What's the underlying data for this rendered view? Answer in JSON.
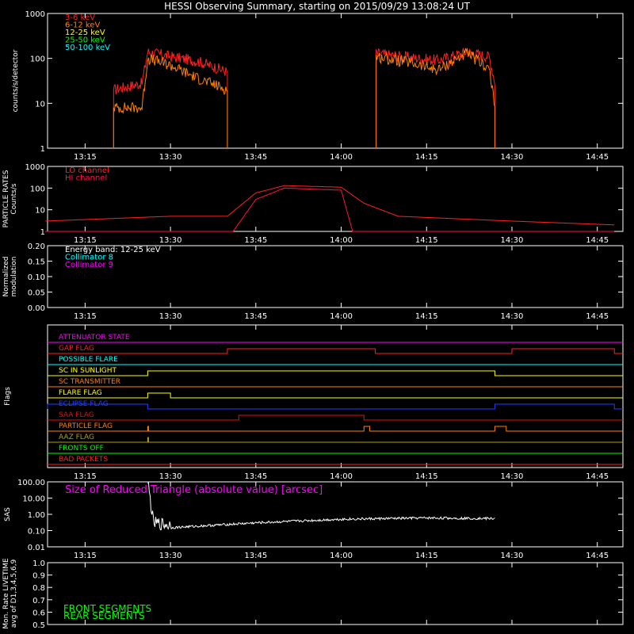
{
  "title": "HESSI Observing Summary, starting on 2015/09/29 13:08:24 UT",
  "time_ticks": [
    "13:15",
    "13:30",
    "13:45",
    "14:00",
    "14:15",
    "14:30",
    "14:45"
  ],
  "colors": {
    "red": "#ff2020",
    "orange": "#ff8000",
    "yellow": "#ffff00",
    "green": "#00ff00",
    "cyan": "#00ffff",
    "magenta": "#ff00ff",
    "crimson": "#ff1040",
    "blue": "#2040ff",
    "olive": "#b0a000",
    "darkred": "#e01010",
    "white": "#ffffff"
  },
  "chart_data": [
    {
      "id": "lightcurves",
      "type": "line",
      "ylabel": "counts/s/detector",
      "yscale": "log",
      "ylim": [
        1,
        1000
      ],
      "ytick_labels": [
        "1",
        "10",
        "100",
        "1000"
      ],
      "legend": [
        {
          "name": "3-6 keV",
          "color": "red"
        },
        {
          "name": "6-12 keV",
          "color": "orange"
        },
        {
          "name": "12-25 keV",
          "color": "yellow"
        },
        {
          "name": "25-50 keV",
          "color": "green"
        },
        {
          "name": "50-100 keV",
          "color": "cyan"
        }
      ],
      "series": [
        {
          "name": "3-6 keV",
          "color": "red",
          "x": [
            "13:20",
            "13:25",
            "13:26",
            "13:30",
            "13:35",
            "13:40",
            "14:06",
            "14:12",
            "14:17",
            "14:22",
            "14:26",
            "14:27"
          ],
          "y": [
            20,
            28,
            140,
            110,
            85,
            50,
            130,
            105,
            90,
            140,
            110,
            30
          ]
        },
        {
          "name": "6-12 keV",
          "color": "orange",
          "x": [
            "13:20",
            "13:25",
            "13:26",
            "13:30",
            "13:35",
            "13:40",
            "14:06",
            "14:12",
            "14:17",
            "14:22",
            "14:26",
            "14:27"
          ],
          "y": [
            8,
            8,
            100,
            70,
            35,
            20,
            110,
            80,
            55,
            130,
            60,
            8
          ]
        },
        {
          "name": "12-25 keV",
          "color": "yellow",
          "x": [
            "13:20",
            "13:40",
            "14:06",
            "14:27"
          ],
          "y": [
            12,
            12,
            12,
            10
          ]
        },
        {
          "name": "25-50 keV",
          "color": "green",
          "x": [
            "13:20",
            "13:40",
            "14:06",
            "14:27"
          ],
          "y": [
            18,
            18,
            20,
            17
          ]
        },
        {
          "name": "50-100 keV",
          "color": "cyan",
          "x": [
            "13:20",
            "13:40",
            "14:06",
            "14:27"
          ],
          "y": [
            28,
            30,
            40,
            33
          ]
        }
      ]
    },
    {
      "id": "particle",
      "type": "line",
      "ylabel": "PARTICLE RATES Counts/s",
      "yscale": "log",
      "ylim": [
        1,
        1000
      ],
      "ytick_labels": [
        "1",
        "10",
        "100",
        "1000"
      ],
      "legend": [
        {
          "name": "LO channel",
          "color": "red"
        },
        {
          "name": "HI channel",
          "color": "crimson"
        }
      ],
      "series": [
        {
          "name": "LO channel",
          "color": "red",
          "x": [
            "13:08",
            "13:30",
            "13:40",
            "13:45",
            "13:50",
            "14:00",
            "14:04",
            "14:10",
            "14:30",
            "14:48"
          ],
          "y": [
            3,
            5,
            5,
            60,
            130,
            110,
            20,
            5,
            3,
            2
          ]
        },
        {
          "name": "HI channel",
          "color": "crimson",
          "x": [
            "13:08",
            "13:41",
            "13:45",
            "13:50",
            "14:00",
            "14:02",
            "14:48"
          ],
          "y": [
            1,
            1,
            30,
            100,
            80,
            1,
            1
          ]
        }
      ]
    },
    {
      "id": "modulation",
      "type": "line",
      "ylabel": "Normalized modulation",
      "ylim": [
        0,
        0.2
      ],
      "ytick_labels": [
        "0.00",
        "0.05",
        "0.10",
        "0.15",
        "0.20"
      ],
      "legend": [
        {
          "name": "Energy band: 12-25 keV",
          "color": "white"
        },
        {
          "name": "Collimator 8",
          "color": "cyan"
        },
        {
          "name": "Collimator 9",
          "color": "magenta"
        }
      ],
      "series": [
        {
          "name": "Collimator 8",
          "color": "cyan",
          "x": [
            "13:20",
            "13:40",
            "14:06",
            "14:30"
          ],
          "y": [
            0.1,
            0.11,
            0.14,
            0.11
          ]
        },
        {
          "name": "Collimator 9",
          "color": "magenta",
          "x": [
            "13:08",
            "14:48"
          ],
          "y": [
            0,
            0
          ]
        }
      ]
    },
    {
      "id": "flags",
      "type": "line",
      "ylabel": "Flags",
      "flags": [
        {
          "name": "ATTENUATOR STATE",
          "color": "magenta",
          "highs": []
        },
        {
          "name": "GAP FLAG",
          "color": "red",
          "highs": [
            [
              "13:40",
              "14:06"
            ],
            [
              "14:30",
              "14:48"
            ]
          ]
        },
        {
          "name": "POSSIBLE FLARE",
          "color": "cyan",
          "highs": []
        },
        {
          "name": "SC IN SUNLIGHT",
          "color": "yellow",
          "highs": [
            [
              "13:26",
              "14:27"
            ]
          ]
        },
        {
          "name": "SC TRANSMITTER",
          "color": "orange",
          "highs": []
        },
        {
          "name": "FLARE FLAG",
          "color": "yellow",
          "highs": [
            [
              "13:26",
              "13:30"
            ]
          ]
        },
        {
          "name": "ECLIPSE FLAG",
          "color": "blue",
          "highs": [
            [
              "13:08",
              "13:26"
            ],
            [
              "14:27",
              "14:48"
            ]
          ]
        },
        {
          "name": "SAA FLAG",
          "color": "darkred",
          "highs": [
            [
              "13:42",
              "14:04"
            ]
          ]
        },
        {
          "name": "PARTICLE FLAG",
          "color": "orange",
          "highs": [
            [
              "13:26",
              "13:26"
            ],
            [
              "14:04",
              "14:05"
            ],
            [
              "14:27",
              "14:29"
            ]
          ]
        },
        {
          "name": "AAZ FLAG",
          "color": "olive",
          "highs": [
            [
              "13:26",
              "13:26"
            ]
          ]
        },
        {
          "name": "FRONTS OFF",
          "color": "green",
          "highs": []
        },
        {
          "name": "BAD PACKETS",
          "color": "red",
          "highs": []
        }
      ]
    },
    {
      "id": "sas",
      "type": "line",
      "ylabel": "SAS",
      "yscale": "log",
      "ylim": [
        0.01,
        100
      ],
      "ytick_labels": [
        "0.01",
        "0.10",
        "1.00",
        "10.00",
        "100.00"
      ],
      "annotation": "Size of Reduced Triangle (absolute value) [arcsec]",
      "series": [
        {
          "name": "SAS",
          "color": "white",
          "x": [
            "13:26",
            "13:27",
            "13:30",
            "13:45",
            "14:00",
            "14:15",
            "14:27"
          ],
          "y": [
            80,
            0.2,
            0.15,
            0.3,
            0.5,
            0.6,
            0.55
          ]
        }
      ]
    },
    {
      "id": "livetime",
      "type": "line",
      "ylabel": "Mon. Rate LIVETIME avg of D1,3,4,5,6,9",
      "ylim": [
        0.5,
        1.0
      ],
      "ytick_labels": [
        "0.5",
        "0.6",
        "0.7",
        "0.8",
        "0.9",
        "1.0"
      ],
      "legend": [
        {
          "name": "FRONT SEGMENTS",
          "color": "green"
        },
        {
          "name": "REAR SEGMENTS",
          "color": "green"
        }
      ],
      "series": [
        {
          "name": "FRONT SEGMENTS",
          "color": "green",
          "x": [
            "13:20",
            "13:40",
            "14:06",
            "14:30"
          ],
          "y": [
            0.5,
            0.5,
            0.5,
            0.5
          ]
        }
      ]
    }
  ]
}
